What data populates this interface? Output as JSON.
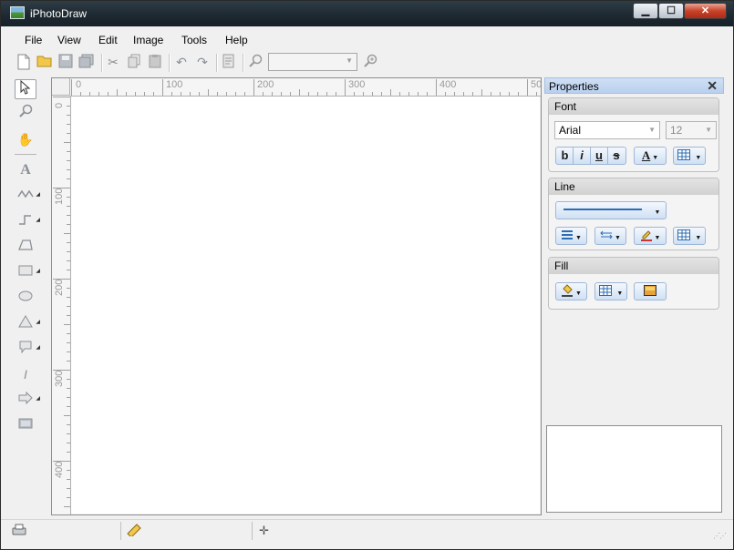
{
  "window": {
    "title": "iPhotoDraw"
  },
  "titlebar_buttons": {
    "minimize": "▁",
    "maximize": "☐",
    "close": "✕"
  },
  "menu": [
    "File",
    "View",
    "Edit",
    "Image",
    "Tools",
    "Help"
  ],
  "toolbar": {
    "icons": [
      "new-document-icon",
      "open-folder-icon",
      "save-icon",
      "save-all-icon",
      "cut-icon",
      "copy-icon",
      "paste-icon",
      "undo-icon",
      "redo-icon",
      "properties-icon",
      "zoom-out-icon",
      "zoom-in-icon"
    ],
    "zoom_value": ""
  },
  "tools": [
    "select-tool",
    "zoom-tool",
    "hand-tool",
    "text-tool",
    "freehand-line-tool",
    "connector-line-tool",
    "polygon-tool",
    "rectangle-tool",
    "ellipse-tool",
    "triangle-tool",
    "callout-tool",
    "text-on-path-tool",
    "arrow-shape-tool",
    "image-tool"
  ],
  "rulers": {
    "horizontal": [
      "0",
      "100",
      "200",
      "300",
      "400",
      "50"
    ],
    "vertical": [
      "0",
      "100",
      "200",
      "300",
      "400"
    ]
  },
  "properties": {
    "title": "Properties",
    "close": "✕",
    "font": {
      "title": "Font",
      "family": "Arial",
      "size": "12",
      "bold": "b",
      "italic": "i",
      "underline": "u",
      "strike": "s",
      "color": "A"
    },
    "line": {
      "title": "Line"
    },
    "fill": {
      "title": "Fill"
    }
  },
  "colors": {
    "accent": "#b9d0ee",
    "canvas": "#ffffff",
    "titlebar": "#1d2830"
  }
}
